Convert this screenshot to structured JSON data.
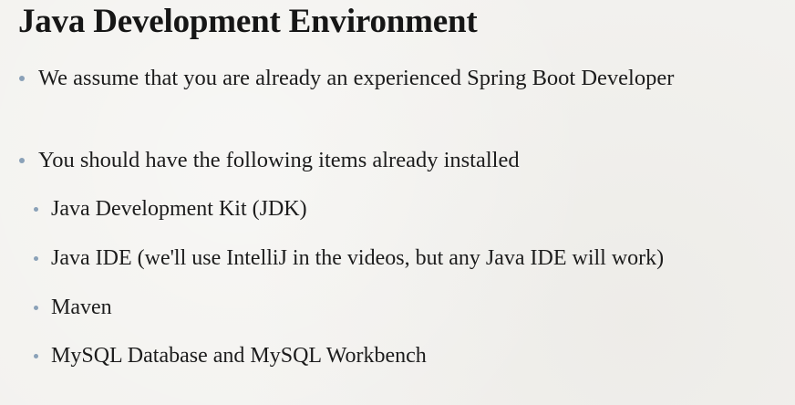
{
  "slide": {
    "title": "Java Development Environment",
    "bullets": [
      {
        "text": "We assume that you are already an experienced Spring Boot Developer"
      },
      {
        "text": "You should have the following items already installed"
      }
    ],
    "sub_bullets": [
      {
        "text": "Java Development Kit (JDK)"
      },
      {
        "text": "Java IDE (we'll use IntelliJ in the videos, but any Java IDE will work)"
      },
      {
        "text": "Maven"
      },
      {
        "text": "MySQL Database and MySQL Workbench"
      }
    ]
  },
  "colors": {
    "background": "#f3f2ef",
    "text": "#1c1c1c",
    "bullet": "#8aa1b8"
  }
}
